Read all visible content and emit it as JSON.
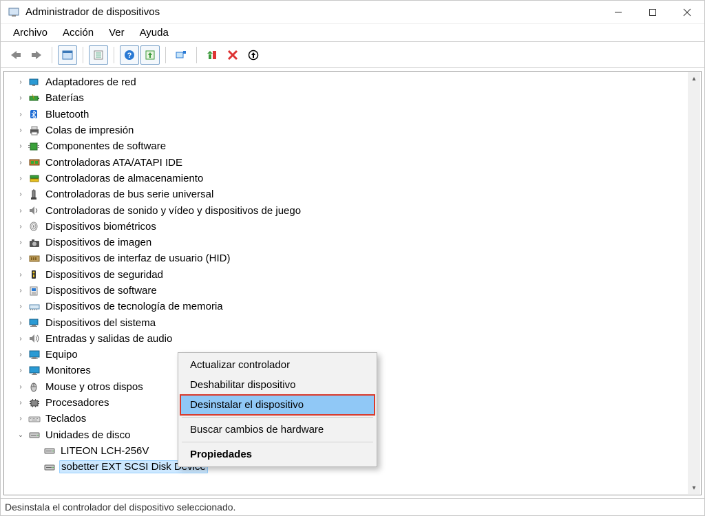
{
  "window": {
    "title": "Administrador de dispositivos"
  },
  "menubar": {
    "items": [
      "Archivo",
      "Acción",
      "Ver",
      "Ayuda"
    ]
  },
  "tree": {
    "items": [
      {
        "label": "Adaptadores de red",
        "icon": "network-icon"
      },
      {
        "label": "Baterías",
        "icon": "battery-icon"
      },
      {
        "label": "Bluetooth",
        "icon": "bluetooth-icon"
      },
      {
        "label": "Colas de impresión",
        "icon": "printer-icon"
      },
      {
        "label": "Componentes de software",
        "icon": "software-component-icon"
      },
      {
        "label": "Controladoras ATA/ATAPI IDE",
        "icon": "ide-controller-icon"
      },
      {
        "label": "Controladoras de almacenamiento",
        "icon": "storage-controller-icon"
      },
      {
        "label": "Controladoras de bus serie universal",
        "icon": "usb-controller-icon"
      },
      {
        "label": "Controladoras de sonido y vídeo y dispositivos de juego",
        "icon": "sound-icon"
      },
      {
        "label": "Dispositivos biométricos",
        "icon": "biometric-icon"
      },
      {
        "label": "Dispositivos de imagen",
        "icon": "camera-icon"
      },
      {
        "label": "Dispositivos de interfaz de usuario (HID)",
        "icon": "hid-icon"
      },
      {
        "label": "Dispositivos de seguridad",
        "icon": "security-device-icon"
      },
      {
        "label": "Dispositivos de software",
        "icon": "software-device-icon"
      },
      {
        "label": "Dispositivos de tecnología de memoria",
        "icon": "memory-tech-icon"
      },
      {
        "label": "Dispositivos del sistema",
        "icon": "system-device-icon"
      },
      {
        "label": "Entradas y salidas de audio",
        "icon": "audio-io-icon"
      },
      {
        "label": "Equipo",
        "icon": "computer-icon"
      },
      {
        "label": "Monitores",
        "icon": "monitor-icon"
      },
      {
        "label": "Mouse y otros dispos",
        "icon": "mouse-icon"
      },
      {
        "label": "Procesadores",
        "icon": "processor-icon"
      },
      {
        "label": "Teclados",
        "icon": "keyboard-icon"
      },
      {
        "label": "Unidades de disco",
        "icon": "disk-drive-icon",
        "expanded": true,
        "children": [
          {
            "label": "LITEON LCH-256V",
            "icon": "disk-drive-icon"
          },
          {
            "label": "sobetter EXT SCSI Disk Device",
            "icon": "disk-drive-icon",
            "selected": true
          }
        ]
      }
    ]
  },
  "context_menu": {
    "items": [
      {
        "label": "Actualizar controlador"
      },
      {
        "label": "Deshabilitar dispositivo"
      },
      {
        "label": "Desinstalar el dispositivo",
        "highlight": true
      },
      {
        "sep": true
      },
      {
        "label": "Buscar cambios de hardware"
      },
      {
        "sep": true
      },
      {
        "label": "Propiedades",
        "bold": true
      }
    ]
  },
  "statusbar": {
    "text": "Desinstala el controlador del dispositivo seleccionado."
  }
}
